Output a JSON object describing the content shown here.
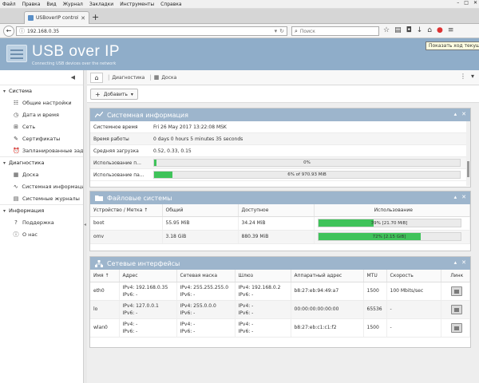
{
  "browser": {
    "menu": [
      "Файл",
      "Правка",
      "Вид",
      "Журнал",
      "Закладки",
      "Инструменты",
      "Справка"
    ],
    "tab_title": "USBoverIP control panel - USB",
    "url": "192.168.0.35",
    "search_placeholder": "Поиск",
    "tooltip": "Показать ход текущих"
  },
  "app": {
    "title": "USB over IP",
    "subtitle": "Connecting USB devices over the network"
  },
  "sidebar": {
    "groups": [
      {
        "label": "Система",
        "items": [
          {
            "label": "Общие настройки",
            "icon": "sliders-icon"
          },
          {
            "label": "Дата и время",
            "icon": "clock-icon"
          },
          {
            "label": "Сеть",
            "icon": "network-icon"
          },
          {
            "label": "Сертификаты",
            "icon": "certificate-icon"
          },
          {
            "label": "Запланированные задачи",
            "icon": "alarm-icon"
          }
        ]
      },
      {
        "label": "Диагностика",
        "items": [
          {
            "label": "Доска",
            "icon": "dashboard-icon"
          },
          {
            "label": "Системная информация",
            "icon": "chart-icon"
          },
          {
            "label": "Системные журналы",
            "icon": "log-icon"
          }
        ]
      },
      {
        "label": "Информация",
        "items": [
          {
            "label": "Поддержка",
            "icon": "question-icon"
          },
          {
            "label": "О нас",
            "icon": "info-icon"
          }
        ]
      }
    ]
  },
  "breadcrumb": {
    "items": [
      "Диагностика",
      "Доска"
    ]
  },
  "toolbar": {
    "add_label": "Добавить"
  },
  "sysinfo": {
    "title": "Системная информация",
    "rows": [
      {
        "key": "Системное время",
        "value": "Fri 26 May 2017 13:22:08 MSK"
      },
      {
        "key": "Время работы",
        "value": "0 days 0 hours 5 minutes 35 seconds"
      },
      {
        "key": "Средняя загрузка",
        "value": "0.52, 0.33, 0.15"
      }
    ],
    "cpu": {
      "key": "Использование п...",
      "label": "0%",
      "fraction": 0.0
    },
    "mem": {
      "key": "Использование па...",
      "label": "6% of 970.93 MiB",
      "fraction": 0.06
    }
  },
  "filesystems": {
    "title": "Файловые системы",
    "headers": [
      "Устройство / Метка",
      "Общий",
      "Доступное",
      "Использование"
    ],
    "sort_arrow": "↑",
    "rows": [
      {
        "device": "boot",
        "total": "55.95 MiB",
        "avail": "34.24 MiB",
        "usage_label": "39% [21.70 MiB]",
        "fraction": 0.39
      },
      {
        "device": "omv",
        "total": "3.18 GiB",
        "avail": "880.39 MiB",
        "usage_label": "72% [2.15 GiB]",
        "fraction": 0.72
      }
    ]
  },
  "network": {
    "title": "Сетевые интерфейсы",
    "headers": [
      "Имя",
      "Адрес",
      "Сетевая маска",
      "Шлюз",
      "Аппаратный адрес",
      "MTU",
      "Скорость",
      "Линк"
    ],
    "sort_arrow": "↑",
    "rows": [
      {
        "name": "eth0",
        "addr4": "IPv4: 192.168.0.35",
        "addr6": "IPv6: -",
        "mask4": "IPv4: 255.255.255.0",
        "mask6": "IPv6: -",
        "gw4": "IPv4: 192.168.0.2",
        "gw6": "IPv6: -",
        "hw": "b8:27:eb:94:49:a7",
        "mtu": "1500",
        "speed": "100 Mbits/sec"
      },
      {
        "name": "lo",
        "addr4": "IPv4: 127.0.0.1",
        "addr6": "IPv6: -",
        "mask4": "IPv4: 255.0.0.0",
        "mask6": "IPv6: -",
        "gw4": "IPv4: -",
        "gw6": "IPv6: -",
        "hw": "00:00:00:00:00:00",
        "mtu": "65536",
        "speed": "-"
      },
      {
        "name": "wlan0",
        "addr4": "IPv4: -",
        "addr6": "IPv6: -",
        "mask4": "IPv4: -",
        "mask6": "IPv6: -",
        "gw4": "IPv4: -",
        "gw6": "IPv6: -",
        "hw": "b8:27:eb:c1:c1:f2",
        "mtu": "1500",
        "speed": "-"
      }
    ]
  },
  "colors": {
    "header_bg": "#8fadc9",
    "panel_header": "#9db5cc",
    "bar_fill": "#3fc35a"
  }
}
